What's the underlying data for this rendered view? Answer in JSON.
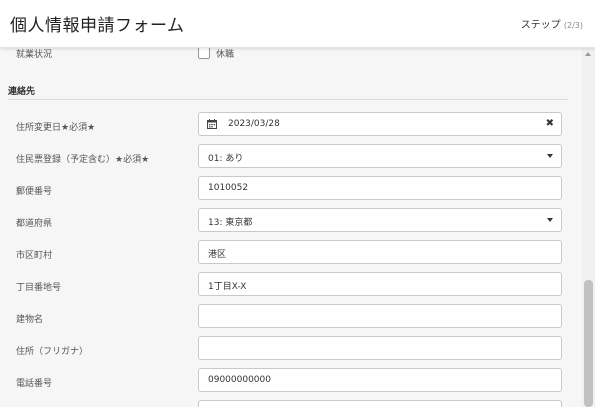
{
  "header": {
    "title": "個人情報申請フォーム",
    "step_label": "ステップ",
    "step_progress": "(2/3)"
  },
  "form": {
    "employment_label": "就業状況",
    "employment_option": "休職",
    "section_title": "連絡先",
    "fields": [
      {
        "label": "住所変更日★必須★",
        "value": "2023/03/28",
        "type": "date"
      },
      {
        "label": "住民票登録（予定含む）★必須★",
        "value": "01: あり",
        "type": "select"
      },
      {
        "label": "郵便番号",
        "value": "1010052",
        "type": "text"
      },
      {
        "label": "都道府県",
        "value": "13: 東京都",
        "type": "select"
      },
      {
        "label": "市区町村",
        "value": "港区",
        "type": "text"
      },
      {
        "label": "丁目番地号",
        "value": "1丁目X-X",
        "type": "text"
      },
      {
        "label": "建物名",
        "value": "",
        "type": "text"
      },
      {
        "label": "住所（フリガナ）",
        "value": "",
        "type": "text"
      },
      {
        "label": "電話番号",
        "value": "09000000000",
        "type": "text"
      }
    ]
  },
  "icons": {
    "calendar": "calendar-icon",
    "clear": "clear-icon",
    "dropdown": "chevron-down-icon"
  }
}
